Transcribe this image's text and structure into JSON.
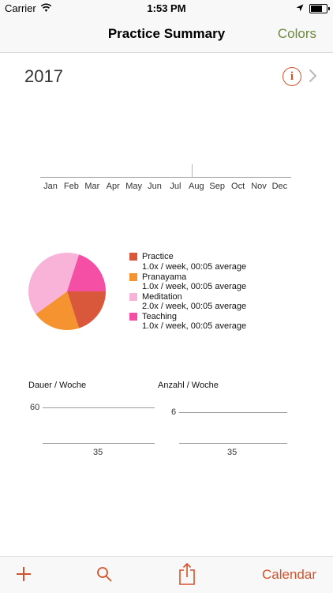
{
  "status_bar": {
    "carrier": "Carrier",
    "time": "1:53 PM"
  },
  "nav": {
    "title": "Practice Summary",
    "colors_label": "Colors"
  },
  "year": "2017",
  "accent_color": "#d2532a",
  "month_chart": {
    "type": "bar",
    "categories": [
      "Jan",
      "Feb",
      "Mar",
      "Apr",
      "May",
      "Jun",
      "Jul",
      "Aug",
      "Sep",
      "Oct",
      "Nov",
      "Dec"
    ],
    "values": [
      0,
      0,
      0,
      0,
      0,
      0,
      0,
      1,
      0,
      0,
      0,
      0
    ],
    "bar_color": "#f58fc7"
  },
  "chart_data": [
    {
      "type": "pie",
      "slices": [
        {
          "name": "Practice",
          "value": 1.0,
          "color": "#d9573a"
        },
        {
          "name": "Pranayama",
          "value": 1.0,
          "color": "#f59331"
        },
        {
          "name": "Meditation",
          "value": 2.0,
          "color": "#f9b3d9"
        },
        {
          "name": "Teaching",
          "value": 1.0,
          "color": "#f54fa5"
        }
      ]
    },
    {
      "type": "line",
      "title": "Dauer / Woche",
      "y_ticks": [
        "60"
      ],
      "x_ticks": [
        "35"
      ]
    },
    {
      "type": "line",
      "title": "Anzahl / Woche",
      "y_ticks": [
        "6"
      ],
      "x_ticks": [
        "35"
      ]
    }
  ],
  "legend": [
    {
      "name": "Practice",
      "stats": "1.0x / week, 00:05 average",
      "color": "#d9573a"
    },
    {
      "name": "Pranayama",
      "stats": "1.0x / week, 00:05 average",
      "color": "#f59331"
    },
    {
      "name": "Meditation",
      "stats": "2.0x / week, 00:05 average",
      "color": "#f9b3d9"
    },
    {
      "name": "Teaching",
      "stats": "1.0x / week, 00:05 average",
      "color": "#f54fa5"
    }
  ],
  "tab_bar": {
    "calendar_label": "Calendar"
  }
}
